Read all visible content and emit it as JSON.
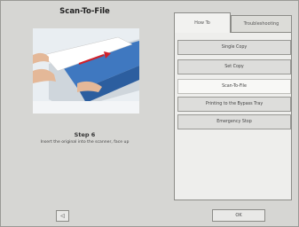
{
  "dialog": {
    "title": "Scan-To-File"
  },
  "step": {
    "title": "Step 6",
    "instruction": "Insert the original into the scanner, face up"
  },
  "tabs": [
    {
      "label": "How To",
      "selected": true
    },
    {
      "label": "Troubleshooting",
      "selected": false
    }
  ],
  "menu": [
    {
      "label": "Single Copy",
      "selected": false
    },
    {
      "label": "Set Copy",
      "selected": false
    },
    {
      "label": "Scan-To-File",
      "selected": true
    },
    {
      "label": "Printing to the Bypass Tray",
      "selected": false
    },
    {
      "label": "Emergency Stop",
      "selected": false
    }
  ],
  "footer": {
    "back_symbol": "◁",
    "ok_label": "OK"
  }
}
